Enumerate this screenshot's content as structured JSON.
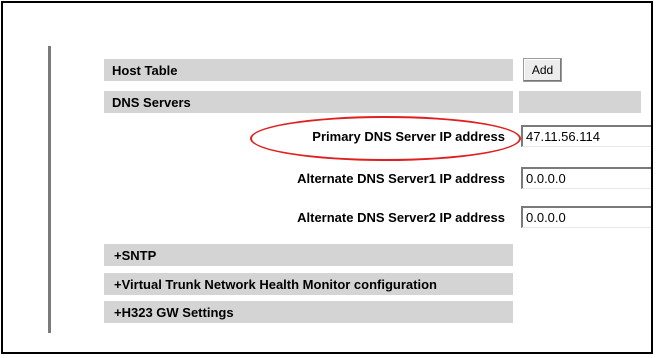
{
  "host_table": {
    "label": "Host Table",
    "add_button_label": "Add"
  },
  "dns_servers": {
    "header": "DNS Servers",
    "primary": {
      "label": "Primary DNS Server IP address",
      "value": "47.11.56.114"
    },
    "alternate1": {
      "label": "Alternate DNS Server1 IP address",
      "value": "0.0.0.0"
    },
    "alternate2": {
      "label": "Alternate DNS Server2 IP address",
      "value": "0.0.0.0"
    }
  },
  "sections": [
    {
      "label": "+SNTP"
    },
    {
      "label": "+Virtual Trunk Network Health Monitor configuration"
    },
    {
      "label": "+H323 GW Settings"
    }
  ],
  "colors": {
    "bar": "#d4d4d4",
    "highlight": "#e02020"
  }
}
